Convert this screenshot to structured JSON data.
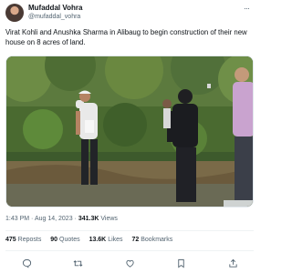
{
  "tweet": {
    "author": {
      "display_name": "Mufaddal Vohra",
      "handle": "@mufaddal_vohra"
    },
    "text": "Virat Kohli and Anushka Sharma in Alibaug to begin construction of their new house on 8 acres of land.",
    "meta": {
      "time": "1:43 PM",
      "separator": "·",
      "date": "Aug 14, 2023",
      "views_count": "341.3K",
      "views_label": "Views"
    },
    "stats": [
      {
        "count": "475",
        "label": "Reposts"
      },
      {
        "count": "90",
        "label": "Quotes"
      },
      {
        "count": "13.6K",
        "label": "Likes"
      },
      {
        "count": "72",
        "label": "Bookmarks"
      }
    ],
    "actions": [
      {
        "icon": "reply-icon"
      },
      {
        "icon": "repost-icon"
      },
      {
        "icon": "like-icon"
      },
      {
        "icon": "bookmark-icon"
      },
      {
        "icon": "share-icon"
      }
    ],
    "more_icon": "more-icon"
  },
  "colors": {
    "text_primary": "#0f1419",
    "text_secondary": "#536471",
    "divider": "#eff3f4"
  }
}
